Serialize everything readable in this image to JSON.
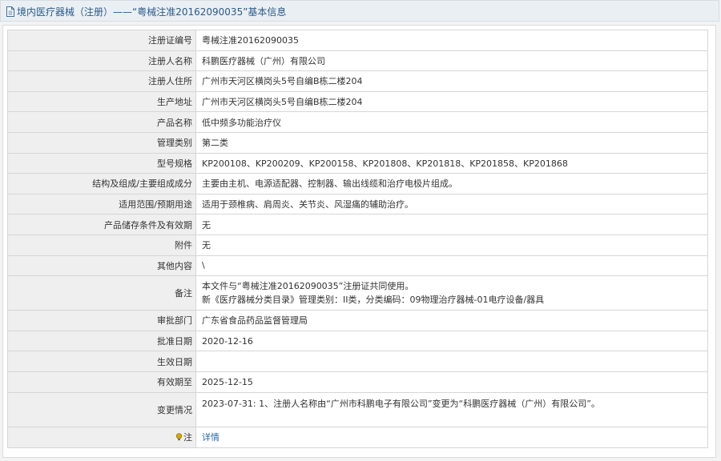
{
  "header": {
    "title": "境内医疗器械（注册）——“粤械注准20162090035”基本信息"
  },
  "rows": [
    {
      "label": "注册证编号",
      "value": "粤械注准20162090035"
    },
    {
      "label": "注册人名称",
      "value": "科鹏医疗器械（广州）有限公司"
    },
    {
      "label": "注册人住所",
      "value": "广州市天河区横岗头5号自编B栋二楼204"
    },
    {
      "label": "生产地址",
      "value": "广州市天河区横岗头5号自编B栋二楼204"
    },
    {
      "label": "产品名称",
      "value": "低中频多功能治疗仪"
    },
    {
      "label": "管理类别",
      "value": "第二类"
    },
    {
      "label": "型号规格",
      "value": "KP200108、KP200209、KP200158、KP201808、KP201818、KP201858、KP201868"
    },
    {
      "label": "结构及组成/主要组成成分",
      "value": "主要由主机、电源适配器、控制器、输出线缆和治疗电极片组成。"
    },
    {
      "label": "适用范围/预期用途",
      "value": "适用于颈椎病、肩周炎、关节炎、风湿痛的辅助治疗。"
    },
    {
      "label": "产品储存条件及有效期",
      "value": "无"
    },
    {
      "label": "附件",
      "value": "无"
    },
    {
      "label": "其他内容",
      "value": "\\"
    },
    {
      "label": "备注",
      "line1": "本文件与“粤械注准20162090035”注册证共同使用。",
      "line2": "新《医疗器械分类目录》管理类别：II类，分类编码：09物理治疗器械-01电疗设备/器具"
    },
    {
      "label": "审批部门",
      "value": "广东省食品药品监督管理局"
    },
    {
      "label": "批准日期",
      "value": "2020-12-16"
    },
    {
      "label": "生效日期",
      "value": ""
    },
    {
      "label": "有效期至",
      "value": "2025-12-15"
    },
    {
      "label": "变更情况",
      "value": "2023-07-31: 1、注册人名称由“广州市科鹏电子有限公司”变更为“科鹏医疗器械（广州）有限公司”。"
    },
    {
      "label": "注",
      "value": "详情"
    }
  ]
}
